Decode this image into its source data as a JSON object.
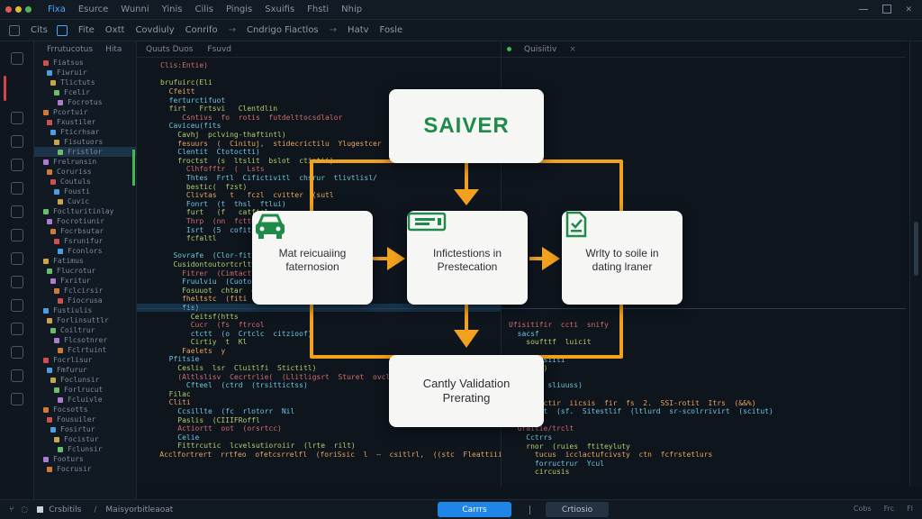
{
  "titlebar": {
    "menu": [
      "Fixa",
      "Esurce",
      "Wunni",
      "Yinis",
      "Cilis",
      "Pingis",
      "Sxuifis",
      "Fhsti",
      "Nhip"
    ],
    "traffic_colors": [
      "#e25a4f",
      "#e6b83a",
      "#4fb55a"
    ]
  },
  "toolbar": {
    "items": [
      "Cits",
      "Fite",
      "Oxtt",
      "Covdiuly",
      "Conrifo",
      "Cndrigo Fiactlos",
      "Hatv",
      "Fosle"
    ]
  },
  "explorer": {
    "tabs": [
      "Frrutucotus",
      "Hita"
    ],
    "rows": [
      "Fiatsus",
      "Fiwruir",
      "Tlictuts",
      "Fcelir",
      "Focrotus",
      "Pcortuir",
      "Fxustiler",
      "Fticrhsar",
      "Fisutuors",
      "Fristlor",
      "Frelrunsin",
      "Coruriss",
      "Coutuls",
      "Fousti",
      "Cuvic",
      "Foclturitinlay",
      "Focrotiunir",
      "Focrbsutar",
      "Fsrunifur",
      "Fconlors",
      "Fatimus",
      "Flucrotur",
      "Fxritur",
      "Fclcirsir",
      "Fiocrusa",
      "Fustiulis",
      "Forlinsuttlr",
      "Coiltrur",
      "Flcsotnrer",
      "Fclrtuint",
      "Focrlisur",
      "Fmfurur",
      "Foclunsir",
      "Forlrucut",
      "Fcluivle",
      "Focsotts",
      "Fousuiler",
      "Fosirtur",
      "Focistur",
      "Fclunsir",
      "Footurs",
      "Focrusir"
    ]
  },
  "editor": {
    "tabs": [
      "Quuts Duos",
      "Fsuvd"
    ],
    "lines": [
      "Clis:Entie)",
      "",
      "brufuirc(Eli",
      "  Cfeitt",
      "  ferturctifuot",
      "  firt   Frtsvi   Clentdlin",
      "     Csntivs  fo  rotis  futdelttocsdlalor",
      "  Caviceu(fits",
      "    Cavhj  pclving-thaftintl)",
      "    fesuurs  (  Cinituj,  stidecrictilu  Ylugestcer",
      "    Clentit  Ctotoctti)",
      "    froctst  (s  ltslit  bslot  ctintii)",
      "      Clhfofftr  (  Lsts",
      "      Thtes  Frtl  Cifictivitl  chsrur  tlivtlisl/",
      "      bestic(  fzst)",
      "      Clivtas   t   fczl  cvitter  (sutl",
      "      Fonrt  (t  thsl  ftlui)",
      "      furt   (f   catfisl",
      "      Thrp  (nn  fctte(c   ctintii)",
      "      Isrt  (5  cofit  crt",
      "      fcfaltl",
      "",
      "   Sovrafe  (Clor-fitsin",
      "   Cusidontoutortcrlttiesil",
      "     Fitrer  (Cimtactlu  Celvotr",
      "     Fruulviu  (Cuotor  Cfslits  fcisiitlonsitul",
      "     Fosuuot  chtar  olitsrsutt  cctiterit",
      "     fheltstc  (fiti  scsittlvs",
      "     fis)",
      "       Ceitsf(htts",
      "       Cucr  (fs  ftrcol",
      "       ctctt  (o  Crtclc  citzioof)",
      "       Cirtiy  t  Kl",
      "     Faelets  y",
      "  Pfitsie",
      "    Ceslis  lsr  Cluitlfi  Stictitl)",
      "    (Altlslisv  Cecrtrlie(  (Llitligsrt  Sturet  ovcltir",
      "      Cfteel  (ctrd  (trsittictss)",
      "  Filac",
      "  Cliti",
      "    Ccsillte  (fc  rlotorr  Nil",
      "    Paslis  (CIIIFRoffl",
      "    Actiortt  oot  (orsrtcc)",
      "    Celie",
      "    Fittrcutic  lcvelsutioroiir  (lrte  rilt)",
      "    Acclfortrert  rrtfeo  ofetcsrrelfl  (foriSsic  l  —  csitlrl,  ((stc  Fleattiiiro"
    ]
  },
  "rpane": {
    "tab": "Quisiitiv",
    "lines": [
      "Ufisitifir  ccti  snify",
      "  sacsf",
      "    soufttf  luicit",
      "",
      "    frttsiiti",
      "    (eel)",
      "",
      "  Guuuu  sliuuss)",
      "",
      "  suinfictir  iicsis  fir  fs  2.  SSI-rotit  Itrs  (&&%)",
      "  Dursect  (sf.  Sitestlif  (ltlurd  sr-scolrrivirt  (scitut)",
      "",
      "  Graitie/trclt",
      "    Cctrrs",
      "    rnor  (ruies  ftiteyluty",
      "      tucus  icclactufcivsty  ctn  fcfrstetlurs",
      "      forructrur  Ycul",
      "      circusis"
    ]
  },
  "diagram": {
    "title": "SAIVER",
    "left": {
      "line1": "Mat reicuaiing",
      "line2": "faternosion"
    },
    "center": {
      "line1": "Infictestions in",
      "line2": "Prestecation"
    },
    "right": {
      "line1": "Wrlty to soile in",
      "line2": "dating lraner"
    },
    "bottom": {
      "line1": "Cantly Validation",
      "line2": "Prerating"
    },
    "colors": {
      "arrow": "#f2a11e",
      "icon": "#1f8a4a",
      "card": "#f6f7f5"
    }
  },
  "status": {
    "left": "Crsbitils",
    "path": "Maisyorbitleaoat",
    "primary_button": "Carrrs",
    "secondary_button": "Crtiosio",
    "right_items": [
      "Cobs",
      "Frc",
      "Fl"
    ]
  }
}
